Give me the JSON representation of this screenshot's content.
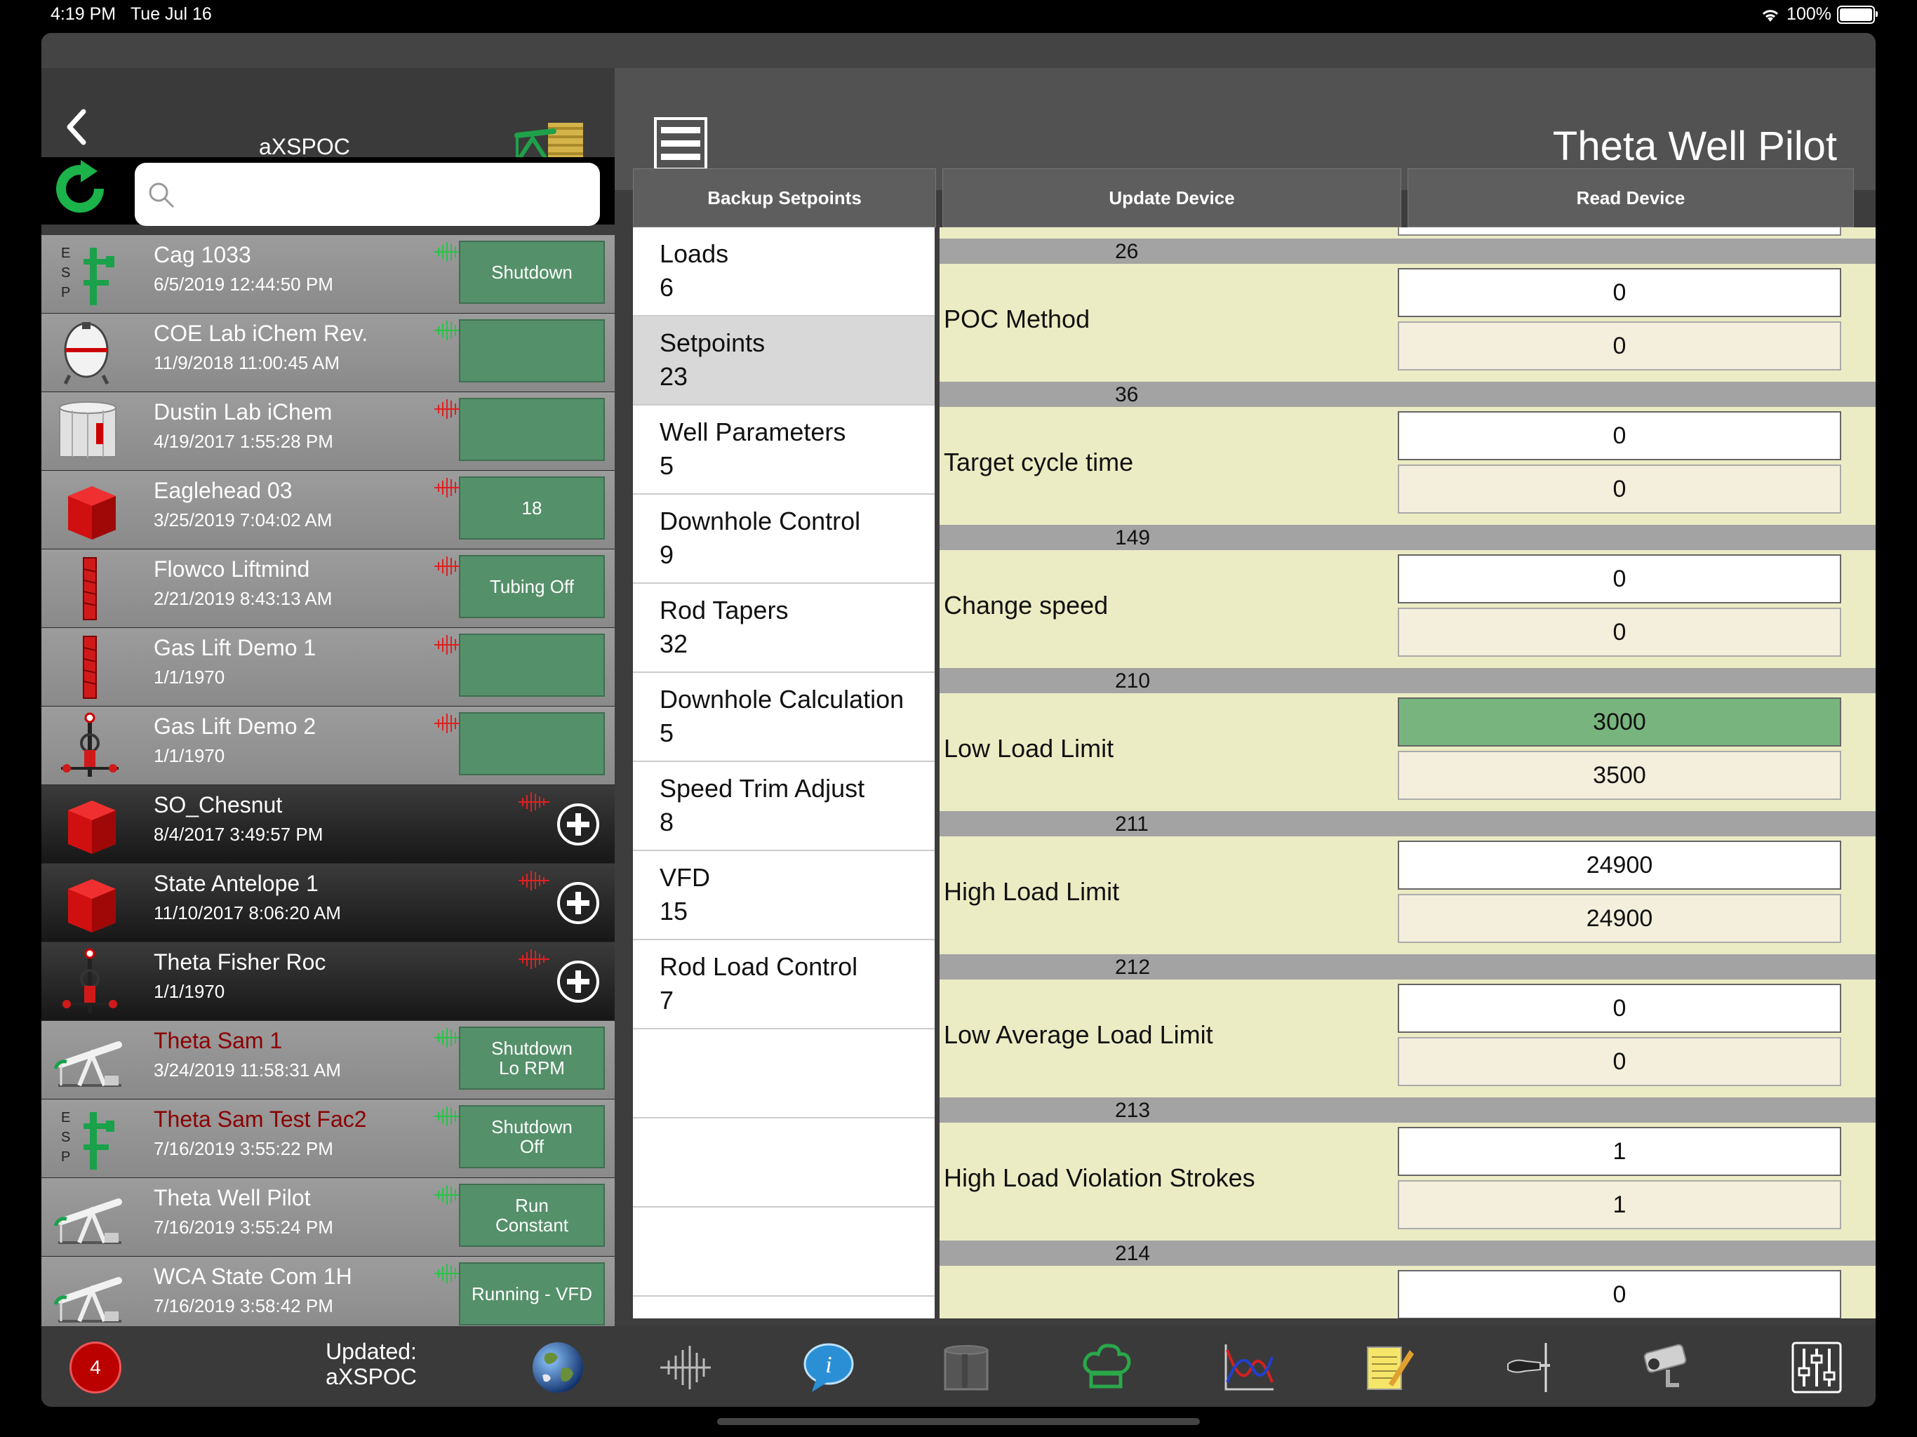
{
  "status_bar": {
    "time": "4:19 PM",
    "date": "Tue Jul 16",
    "battery": "100%"
  },
  "left_header": {
    "title": "aXSPOC"
  },
  "right_header": {
    "title": "Theta Well Pilot"
  },
  "search": {
    "placeholder": ""
  },
  "wells": [
    {
      "name": "Cag 1033",
      "date": "6/5/2019 12:44:50 PM",
      "status": "Shutdown",
      "icon": "esp-icon",
      "signal": "green",
      "style": "light",
      "name_color": "white"
    },
    {
      "name": "COE Lab iChem Rev.",
      "date": "11/9/2018 11:00:45 AM",
      "status": "",
      "icon": "chem-tank-icon",
      "signal": "green",
      "style": "light",
      "name_color": "white"
    },
    {
      "name": "Dustin Lab iChem",
      "date": "4/19/2017 1:55:28 PM",
      "status": "",
      "icon": "storage-tank-icon",
      "signal": "red",
      "style": "light",
      "name_color": "white"
    },
    {
      "name": "Eaglehead 03",
      "date": "3/25/2019 7:04:02 AM",
      "status": "18",
      "icon": "red-cube-icon",
      "signal": "red",
      "style": "light",
      "name_color": "white"
    },
    {
      "name": "Flowco Liftmind",
      "date": "2/21/2019 8:43:13 AM",
      "status": "Tubing Off",
      "icon": "gas-lift-tube-icon",
      "signal": "red",
      "style": "light",
      "name_color": "white"
    },
    {
      "name": "Gas Lift Demo 1",
      "date": "1/1/1970",
      "status": "",
      "icon": "gas-lift-tube-icon",
      "signal": "red",
      "style": "light",
      "name_color": "white"
    },
    {
      "name": "Gas Lift Demo 2",
      "date": "1/1/1970",
      "status": "",
      "icon": "wellhead-icon",
      "signal": "red",
      "style": "light",
      "name_color": "white"
    },
    {
      "name": "SO_Chesnut",
      "date": "8/4/2017 3:49:57 PM",
      "status": null,
      "icon": "red-cube-icon",
      "signal": "red",
      "style": "dark",
      "name_color": "white"
    },
    {
      "name": "State Antelope 1",
      "date": "11/10/2017 8:06:20 AM",
      "status": null,
      "icon": "red-cube-icon",
      "signal": "red",
      "style": "dark",
      "name_color": "white"
    },
    {
      "name": "Theta Fisher Roc",
      "date": "1/1/1970",
      "status": null,
      "icon": "wellhead-icon",
      "signal": "red",
      "style": "dark",
      "name_color": "white"
    },
    {
      "name": "Theta Sam 1",
      "date": "3/24/2019 11:58:31 AM",
      "status": "Shutdown\nLo RPM",
      "icon": "pumpjack-icon",
      "signal": "green",
      "style": "light",
      "name_color": "red"
    },
    {
      "name": "Theta Sam Test Fac2",
      "date": "7/16/2019 3:55:22 PM",
      "status": "Shutdown\nOff",
      "icon": "esp-icon",
      "signal": "green",
      "style": "light",
      "name_color": "red"
    },
    {
      "name": "Theta Well Pilot",
      "date": "7/16/2019 3:55:24 PM",
      "status": "Run\nConstant",
      "icon": "pumpjack-icon",
      "signal": "green",
      "style": "light",
      "name_color": "white"
    },
    {
      "name": "WCA State Com 1H",
      "date": "7/16/2019 3:58:42 PM",
      "status": "Running - VFD",
      "icon": "pumpjack-icon",
      "signal": "green",
      "style": "light",
      "name_color": "white"
    }
  ],
  "tabs": [
    "Backup Setpoints",
    "Update Device",
    "Read Device"
  ],
  "categories": [
    {
      "label": "Loads",
      "count": "6"
    },
    {
      "label": "Setpoints",
      "count": "23",
      "selected": true
    },
    {
      "label": "Well Parameters",
      "count": "5"
    },
    {
      "label": "Downhole Control",
      "count": "9"
    },
    {
      "label": "Rod Tapers",
      "count": "32"
    },
    {
      "label": "Downhole Calculation",
      "count": "5"
    },
    {
      "label": "Speed Trim Adjust",
      "count": "8"
    },
    {
      "label": "VFD",
      "count": "15"
    },
    {
      "label": "Rod Load Control",
      "count": "7"
    },
    {
      "label": "",
      "count": ""
    },
    {
      "label": "",
      "count": ""
    },
    {
      "label": "",
      "count": ""
    }
  ],
  "setpoints": [
    {
      "address": "26",
      "label": "POC Method",
      "new_value": "0",
      "current_value": "0"
    },
    {
      "address": "36",
      "label": "Target cycle time",
      "new_value": "0",
      "current_value": "0"
    },
    {
      "address": "149",
      "label": "Change speed",
      "new_value": "0",
      "current_value": "0"
    },
    {
      "address": "210",
      "label": "Low Load Limit",
      "new_value": "3000",
      "current_value": "3500",
      "changed": true
    },
    {
      "address": "211",
      "label": "High Load Limit",
      "new_value": "24900",
      "current_value": "24900"
    },
    {
      "address": "212",
      "label": "Low Average Load Limit",
      "new_value": "0",
      "current_value": "0"
    },
    {
      "address": "213",
      "label": "High Load Violation Strokes",
      "new_value": "1",
      "current_value": "1"
    },
    {
      "address": "214",
      "label": "",
      "new_value": "0",
      "current_value": ""
    }
  ],
  "bottom_bar": {
    "badge_count": "4",
    "updated_label": "Updated:",
    "updated_source": "aXSPOC"
  },
  "colors": {
    "status_green": "#54906a",
    "changed_green": "#78b57e",
    "row_yellow": "#ececc4",
    "red_alert": "#8b0000"
  }
}
